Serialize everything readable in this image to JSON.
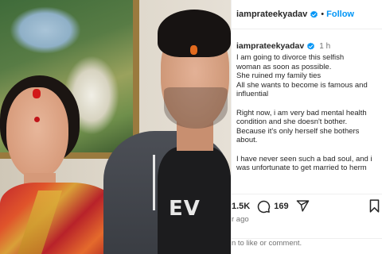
{
  "post": {
    "username": "iamprateekyadav",
    "follow_label": "Follow",
    "separator": "•",
    "time": "1 h",
    "caption_lines": [
      "I am going to divorce this selfish",
      "woman as soon as possible.",
      "She ruined my family ties",
      "All she wants to become is famous and",
      "influential",
      "",
      "Right now, i am very bad mental health",
      "condition and she doesn't bother.",
      "Because it's only herself she bothers",
      "about.",
      "",
      "I have never seen such a bad soul, and i",
      "was unfortunate to get married to herm"
    ],
    "likes": "1.5K",
    "comments": "169",
    "ago_text": "r ago",
    "login_prompt": "n to like or comment."
  },
  "photo": {
    "tshirt_print": "EV"
  },
  "colors": {
    "accent": "#0095f6",
    "text": "#262626",
    "muted": "#737373",
    "verified": "#0095f6"
  },
  "icons": {
    "verified": "verified-badge-icon",
    "comment": "comment-bubble-icon",
    "share": "paper-plane-icon",
    "save": "bookmark-icon"
  }
}
